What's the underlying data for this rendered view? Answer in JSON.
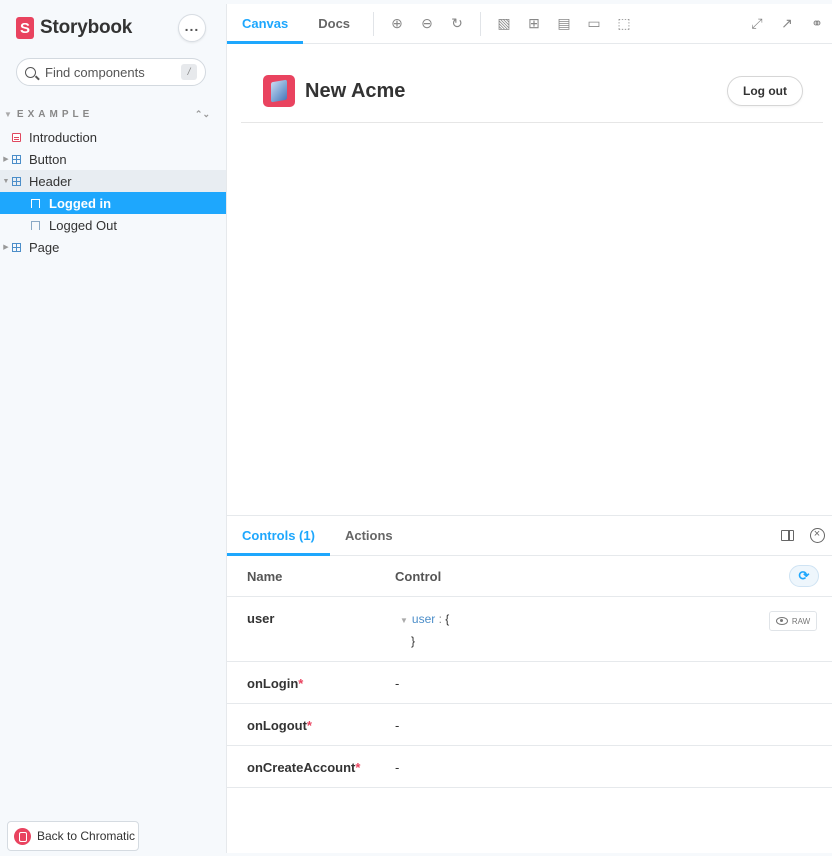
{
  "brand": {
    "logo_letter": "S",
    "name": "Storybook",
    "menu_glyph": "..."
  },
  "search": {
    "placeholder": "Find components",
    "shortcut": "/"
  },
  "sidebar": {
    "section_title": "EXAMPLE",
    "items": [
      {
        "label": "Introduction",
        "icon": "document-icon"
      },
      {
        "label": "Button",
        "icon": "component-icon"
      },
      {
        "label": "Header",
        "icon": "component-icon",
        "expanded": true,
        "children": [
          {
            "label": "Logged in",
            "icon": "bookmark-icon",
            "selected": true
          },
          {
            "label": "Logged Out",
            "icon": "bookmark-icon"
          }
        ]
      },
      {
        "label": "Page",
        "icon": "component-icon"
      }
    ],
    "back_button": "Back to Chromatic"
  },
  "toolbar": {
    "tabs": [
      "Canvas",
      "Docs"
    ],
    "active_tab": "Canvas",
    "tool_icons": [
      "zoom-in-icon",
      "zoom-out-icon",
      "zoom-reset-icon",
      "background-icon",
      "grid-icon",
      "viewport-icon",
      "measure-icon",
      "outline-icon"
    ],
    "right_icons": [
      "fullscreen-icon",
      "open-new-tab-icon",
      "copy-link-icon"
    ]
  },
  "preview": {
    "app_title": "New Acme",
    "logout_label": "Log out"
  },
  "addons": {
    "tabs": [
      "Controls (1)",
      "Actions"
    ],
    "active_tab": "Controls (1)",
    "columns": {
      "name": "Name",
      "control": "Control"
    },
    "rows": [
      {
        "name": "user",
        "required": false,
        "json_key": "user",
        "json_colon": ":",
        "json_open": "{",
        "json_close": "}",
        "raw_label": "RAW"
      },
      {
        "name": "onLogin",
        "required": true,
        "value": "-"
      },
      {
        "name": "onLogout",
        "required": true,
        "value": "-"
      },
      {
        "name": "onCreateAccount",
        "required": true,
        "value": "-"
      }
    ],
    "required_mark": "*"
  },
  "colors": {
    "accent": "#1ea7fd",
    "brand": "#e9435f",
    "sidebar_bg": "#f6f9fc"
  }
}
